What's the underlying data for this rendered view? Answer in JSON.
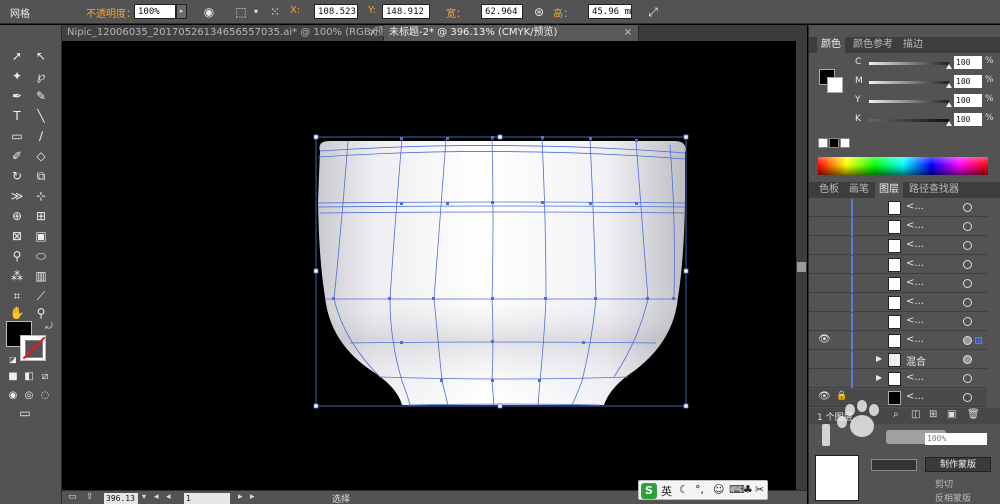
{
  "control_bar": {
    "mode_label": "网格",
    "opacity_label": "不透明度：",
    "opacity_value": "100%",
    "x_label": "X:",
    "x_value": "108.523",
    "y_label": "Y:",
    "y_value": "148.912",
    "w_label": "宽：",
    "w_value": "62.964 m",
    "h_label": "高：",
    "h_value": "45.96 mm"
  },
  "tabs": [
    {
      "label": "Nipic_12006035_20170526134656557035.ai* @ 100% (RGB/预览)"
    },
    {
      "label": "未标题-2* @ 396.13% (CMYK/预览)"
    }
  ],
  "color_panel": {
    "tabs": [
      "颜色",
      "颜色参考",
      "描边"
    ],
    "channels": [
      {
        "name": "C",
        "value": "100"
      },
      {
        "name": "M",
        "value": "100"
      },
      {
        "name": "Y",
        "value": "100"
      },
      {
        "name": "K",
        "value": "100"
      }
    ],
    "pct": "%"
  },
  "layers_panel": {
    "tabs": [
      "色板",
      "画笔",
      "图层",
      "路径查找器"
    ],
    "rows": [
      {
        "name": "<..."
      },
      {
        "name": "<..."
      },
      {
        "name": "<..."
      },
      {
        "name": "<..."
      },
      {
        "name": "<..."
      },
      {
        "name": "<..."
      },
      {
        "name": "<..."
      },
      {
        "name": "<..."
      },
      {
        "name": "混合"
      },
      {
        "name": "<..."
      },
      {
        "name": "<..."
      }
    ],
    "footer": "1 个图层"
  },
  "transparency_panel": {
    "opacity_value": "100%",
    "make_mask_button": "制作蒙版",
    "clip_label": "剪切",
    "invert_label": "反相蒙版"
  },
  "status_bar": {
    "zoom": "396.13",
    "artboard": "1",
    "tool": "选择"
  },
  "ime": {
    "logo": "S",
    "lang": "英"
  }
}
